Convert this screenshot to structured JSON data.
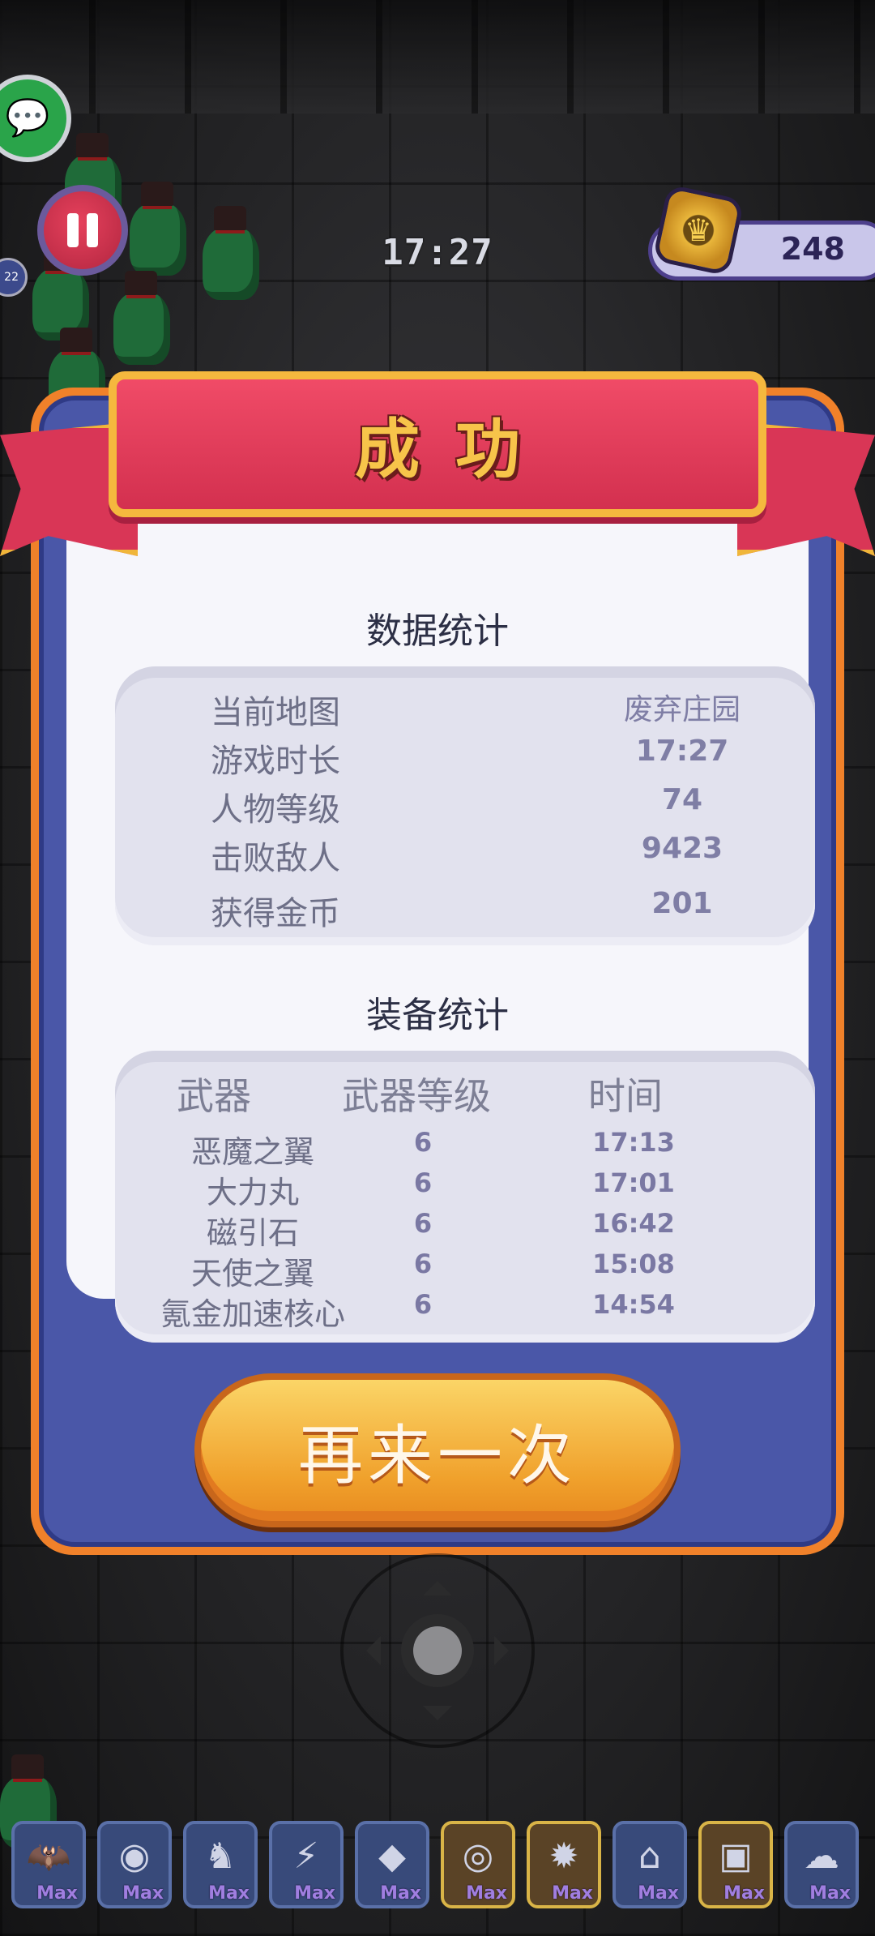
{
  "hud": {
    "timer": "17:27",
    "coins": "248",
    "badge": "22"
  },
  "result": {
    "title": "成功",
    "stats_title": "数据统计",
    "stats": [
      {
        "label": "当前地图",
        "value": "废弃庄园"
      },
      {
        "label": "游戏时长",
        "value": "17:27"
      },
      {
        "label": "人物等级",
        "value": "74"
      },
      {
        "label": "击败敌人",
        "value": "9423"
      },
      {
        "label": "获得金币",
        "value": "201"
      }
    ],
    "equip_title": "装备统计",
    "equip_headers": {
      "weapon": "武器",
      "level": "武器等级",
      "time": "时间"
    },
    "equipment": [
      {
        "name": "恶魔之翼",
        "level": "6",
        "time": "17:13"
      },
      {
        "name": "大力丸",
        "level": "6",
        "time": "17:01"
      },
      {
        "name": "磁引石",
        "level": "6",
        "time": "16:42"
      },
      {
        "name": "天使之翼",
        "level": "6",
        "time": "15:08"
      },
      {
        "name": "氪金加速核心",
        "level": "6",
        "time": "14:54"
      }
    ],
    "retry_label": "再来一次"
  },
  "skills": [
    {
      "icon": "demon-wings-icon",
      "glyph": "🦇",
      "max": "Max",
      "gold": false
    },
    {
      "icon": "orb-icon",
      "glyph": "◉",
      "max": "Max",
      "gold": false
    },
    {
      "icon": "beast-icon",
      "glyph": "♞",
      "max": "Max",
      "gold": false
    },
    {
      "icon": "claw-wings-icon",
      "glyph": "⚡",
      "max": "Max",
      "gold": false
    },
    {
      "icon": "gem-icon",
      "glyph": "◆",
      "max": "Max",
      "gold": false
    },
    {
      "icon": "ring-icon",
      "glyph": "◎",
      "max": "Max",
      "gold": true
    },
    {
      "icon": "shield-icon",
      "glyph": "✹",
      "max": "Max",
      "gold": true
    },
    {
      "icon": "boot-icon",
      "glyph": "⌂",
      "max": "Max",
      "gold": false
    },
    {
      "icon": "chest-icon",
      "glyph": "▣",
      "max": "Max",
      "gold": true
    },
    {
      "icon": "helmet-icon",
      "glyph": "☁",
      "max": "Max",
      "gold": false
    }
  ],
  "colors": {
    "ribbon": "#d93656",
    "panel_border": "#f0812a",
    "panel_inner": "#4a57a8",
    "button": "#f0a12c"
  }
}
